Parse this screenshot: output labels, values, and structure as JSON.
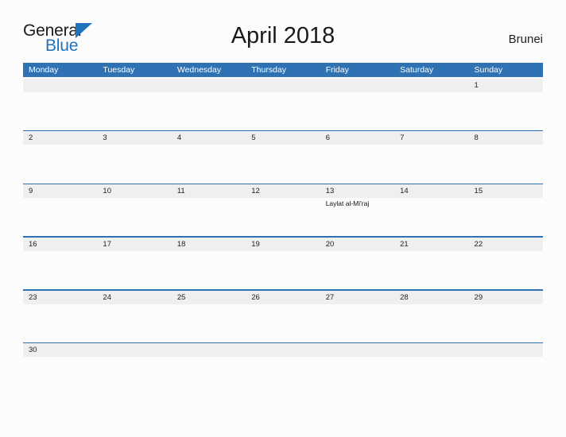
{
  "brand": {
    "name_part1": "General",
    "name_part2": "Blue",
    "flag_icon": "triangle-flag-icon",
    "accent_color": "#1f72bb"
  },
  "header": {
    "title": "April 2018",
    "country": "Brunei"
  },
  "theme": {
    "header_blue": "#2f72b4",
    "rule_blue": "#2f72b4",
    "strip_gray": "#efefef",
    "page_background": "#fcfcfc"
  },
  "calendar": {
    "month": "April",
    "year": "2018",
    "weekday_headers": [
      "Monday",
      "Tuesday",
      "Wednesday",
      "Thursday",
      "Friday",
      "Saturday",
      "Sunday"
    ],
    "weeks": [
      {
        "days": [
          {
            "num": "",
            "event": ""
          },
          {
            "num": "",
            "event": ""
          },
          {
            "num": "",
            "event": ""
          },
          {
            "num": "",
            "event": ""
          },
          {
            "num": "",
            "event": ""
          },
          {
            "num": "",
            "event": ""
          },
          {
            "num": "1",
            "event": ""
          }
        ]
      },
      {
        "days": [
          {
            "num": "2",
            "event": ""
          },
          {
            "num": "3",
            "event": ""
          },
          {
            "num": "4",
            "event": ""
          },
          {
            "num": "5",
            "event": ""
          },
          {
            "num": "6",
            "event": ""
          },
          {
            "num": "7",
            "event": ""
          },
          {
            "num": "8",
            "event": ""
          }
        ]
      },
      {
        "days": [
          {
            "num": "9",
            "event": ""
          },
          {
            "num": "10",
            "event": ""
          },
          {
            "num": "11",
            "event": ""
          },
          {
            "num": "12",
            "event": ""
          },
          {
            "num": "13",
            "event": "Laylat al-Mi'raj"
          },
          {
            "num": "14",
            "event": ""
          },
          {
            "num": "15",
            "event": ""
          }
        ]
      },
      {
        "days": [
          {
            "num": "16",
            "event": ""
          },
          {
            "num": "17",
            "event": ""
          },
          {
            "num": "18",
            "event": ""
          },
          {
            "num": "19",
            "event": ""
          },
          {
            "num": "20",
            "event": ""
          },
          {
            "num": "21",
            "event": ""
          },
          {
            "num": "22",
            "event": ""
          }
        ]
      },
      {
        "days": [
          {
            "num": "23",
            "event": ""
          },
          {
            "num": "24",
            "event": ""
          },
          {
            "num": "25",
            "event": ""
          },
          {
            "num": "26",
            "event": ""
          },
          {
            "num": "27",
            "event": ""
          },
          {
            "num": "28",
            "event": ""
          },
          {
            "num": "29",
            "event": ""
          }
        ]
      },
      {
        "days": [
          {
            "num": "30",
            "event": ""
          },
          {
            "num": "",
            "event": ""
          },
          {
            "num": "",
            "event": ""
          },
          {
            "num": "",
            "event": ""
          },
          {
            "num": "",
            "event": ""
          },
          {
            "num": "",
            "event": ""
          },
          {
            "num": "",
            "event": ""
          }
        ]
      }
    ]
  }
}
